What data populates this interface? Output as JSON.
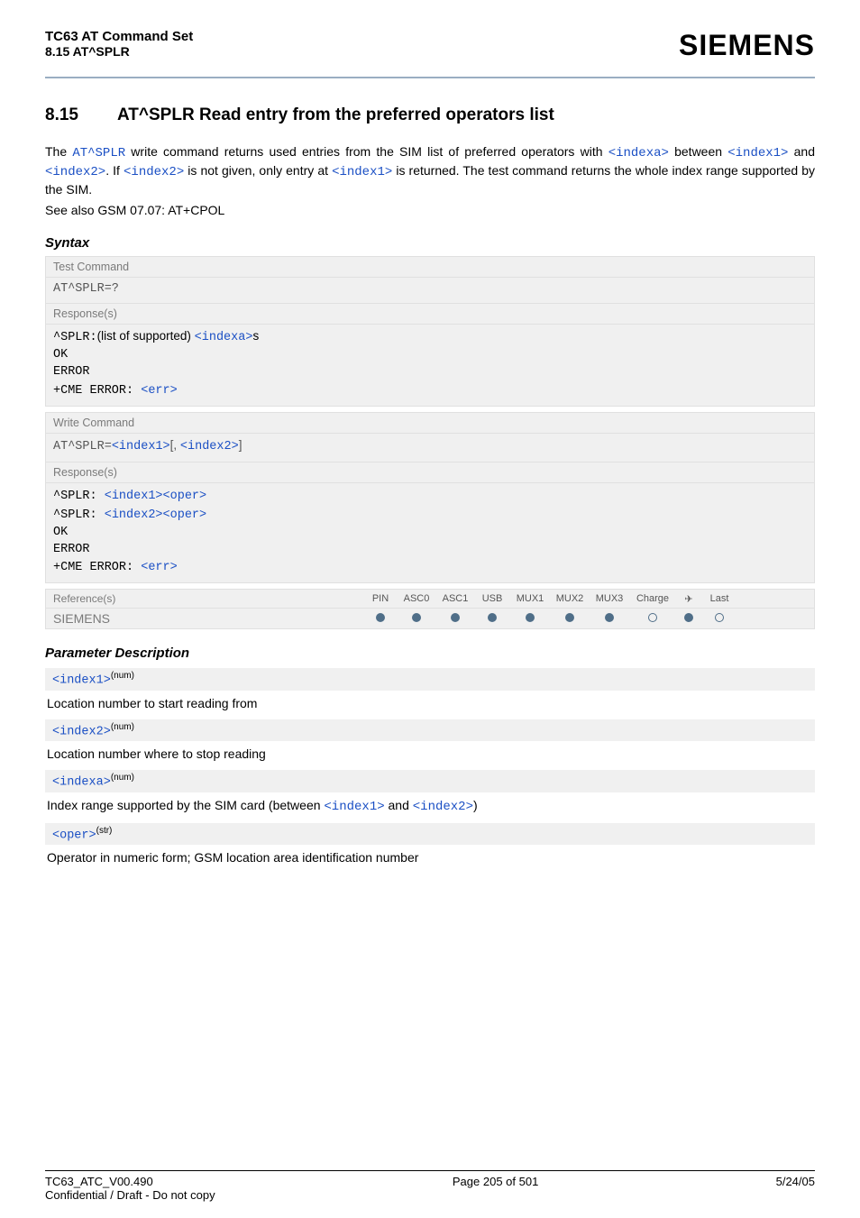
{
  "header": {
    "title": "TC63 AT Command Set",
    "subtitle": "8.15 AT^SPLR",
    "brand": "SIEMENS"
  },
  "section": {
    "number": "8.15",
    "title": "AT^SPLR   Read entry from the preferred operators list"
  },
  "intro": {
    "p1a": "The ",
    "cmd": "AT^SPLR",
    "p1b": " write command returns used entries from the SIM list of preferred operators with ",
    "idxa": "<indexa>",
    "p1c": " between ",
    "idx1": "<index1>",
    "and": " and ",
    "idx2": "<index2>",
    "p1d": ". If ",
    "idx2b": "<index2>",
    "p1e": " is not given, only entry at ",
    "idx1b": "<index1>",
    "p1f": " is returned. The test command returns the whole index range supported by the SIM.",
    "p2": "See also GSM 07.07: AT+CPOL"
  },
  "syntax_label": "Syntax",
  "test_box": {
    "head": "Test Command",
    "cmd": "AT^SPLR=?",
    "resp_label": "Response(s)",
    "l1a": "^SPLR:",
    "l1b": "(list of supported) ",
    "l1c": "<indexa>",
    "l1d": "s",
    "l2": "OK",
    "l3": "ERROR",
    "l4a": "+CME ERROR: ",
    "l4b": "<err>"
  },
  "write_box": {
    "head": "Write Command",
    "cmd_a": "AT^SPLR=",
    "cmd_b": "<index1>",
    "cmd_c": "[, ",
    "cmd_d": "<index2>",
    "cmd_e": "]",
    "resp_label": "Response(s)",
    "l1a": "^SPLR: ",
    "l1b": "<index1>",
    "l1c": "<oper>",
    "l2a": "^SPLR: ",
    "l2b": "<index2>",
    "l2c": "<oper>",
    "l3": "OK",
    "l4": "ERROR",
    "l5a": "+CME ERROR: ",
    "l5b": "<err>"
  },
  "ref": {
    "label": "Reference(s)",
    "value": "SIEMENS",
    "cols": [
      "PIN",
      "ASC0",
      "ASC1",
      "USB",
      "MUX1",
      "MUX2",
      "MUX3",
      "Charge",
      "",
      "Last"
    ],
    "states": [
      "filled",
      "filled",
      "filled",
      "filled",
      "filled",
      "filled",
      "filled",
      "hollow",
      "filled",
      "hollow"
    ]
  },
  "param_label": "Parameter Description",
  "params": [
    {
      "name": "<index1>",
      "type": "(num)",
      "desc": "Location number to start reading from"
    },
    {
      "name": "<index2>",
      "type": "(num)",
      "desc": "Location number where to stop reading"
    },
    {
      "name": "<indexa>",
      "type": "(num)",
      "desc_a": "Index range supported by the SIM card (between ",
      "link1": "<index1>",
      "mid": " and ",
      "link2": "<index2>",
      "desc_b": ")"
    },
    {
      "name": "<oper>",
      "type": "(str)",
      "desc": "Operator in numeric form; GSM location area identification number"
    }
  ],
  "footer": {
    "left1": "TC63_ATC_V00.490",
    "left2": "Confidential / Draft - Do not copy",
    "center": "Page 205 of 501",
    "right": "5/24/05"
  }
}
